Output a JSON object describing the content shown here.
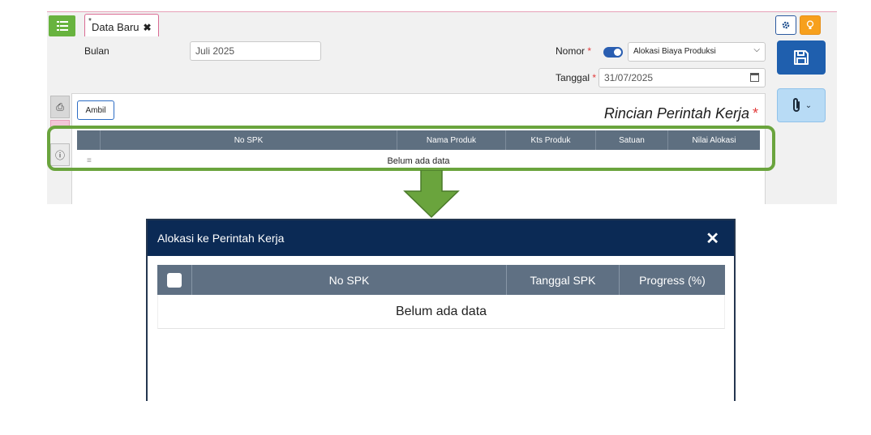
{
  "app": {
    "tab": {
      "modified_marker": "*",
      "label": "Data Baru",
      "close_glyph": "✖"
    },
    "form": {
      "bulan_label": "Bulan",
      "bulan_value": "Juli 2025",
      "nomor_label": "Nomor",
      "nomor_select_value": "Alokasi Biaya Produksi",
      "tanggal_label": "Tanggal",
      "tanggal_value": "31/07/2025",
      "required_marker": "*"
    },
    "ambil_button": "Ambil",
    "section_title": "Rincian Perintah Kerja",
    "grid": {
      "columns": [
        "No SPK",
        "Nama Produk",
        "Kts Produk",
        "Satuan",
        "Nilai Alokasi"
      ],
      "empty_text": "Belum ada data",
      "row_handle": "≡"
    },
    "icons": [
      "menu-icon",
      "gear-icon",
      "lightbulb-icon",
      "save-icon",
      "paperclip-icon",
      "chevron-down-icon",
      "print-icon",
      "info-icon",
      "calendar-icon"
    ]
  },
  "modal": {
    "title": "Alokasi ke Perintah Kerja",
    "close": "✕",
    "columns": [
      "No SPK",
      "Tanggal SPK",
      "Progress (%)"
    ],
    "empty_text": "Belum ada data"
  },
  "colors": {
    "menu_green": "#68b33f",
    "primary_blue": "#1f5fae",
    "grid_header": "#5e6f80",
    "modal_header": "#0b2a55",
    "highlight_green": "#6aa43d",
    "bulb_orange": "#f7a01c"
  }
}
